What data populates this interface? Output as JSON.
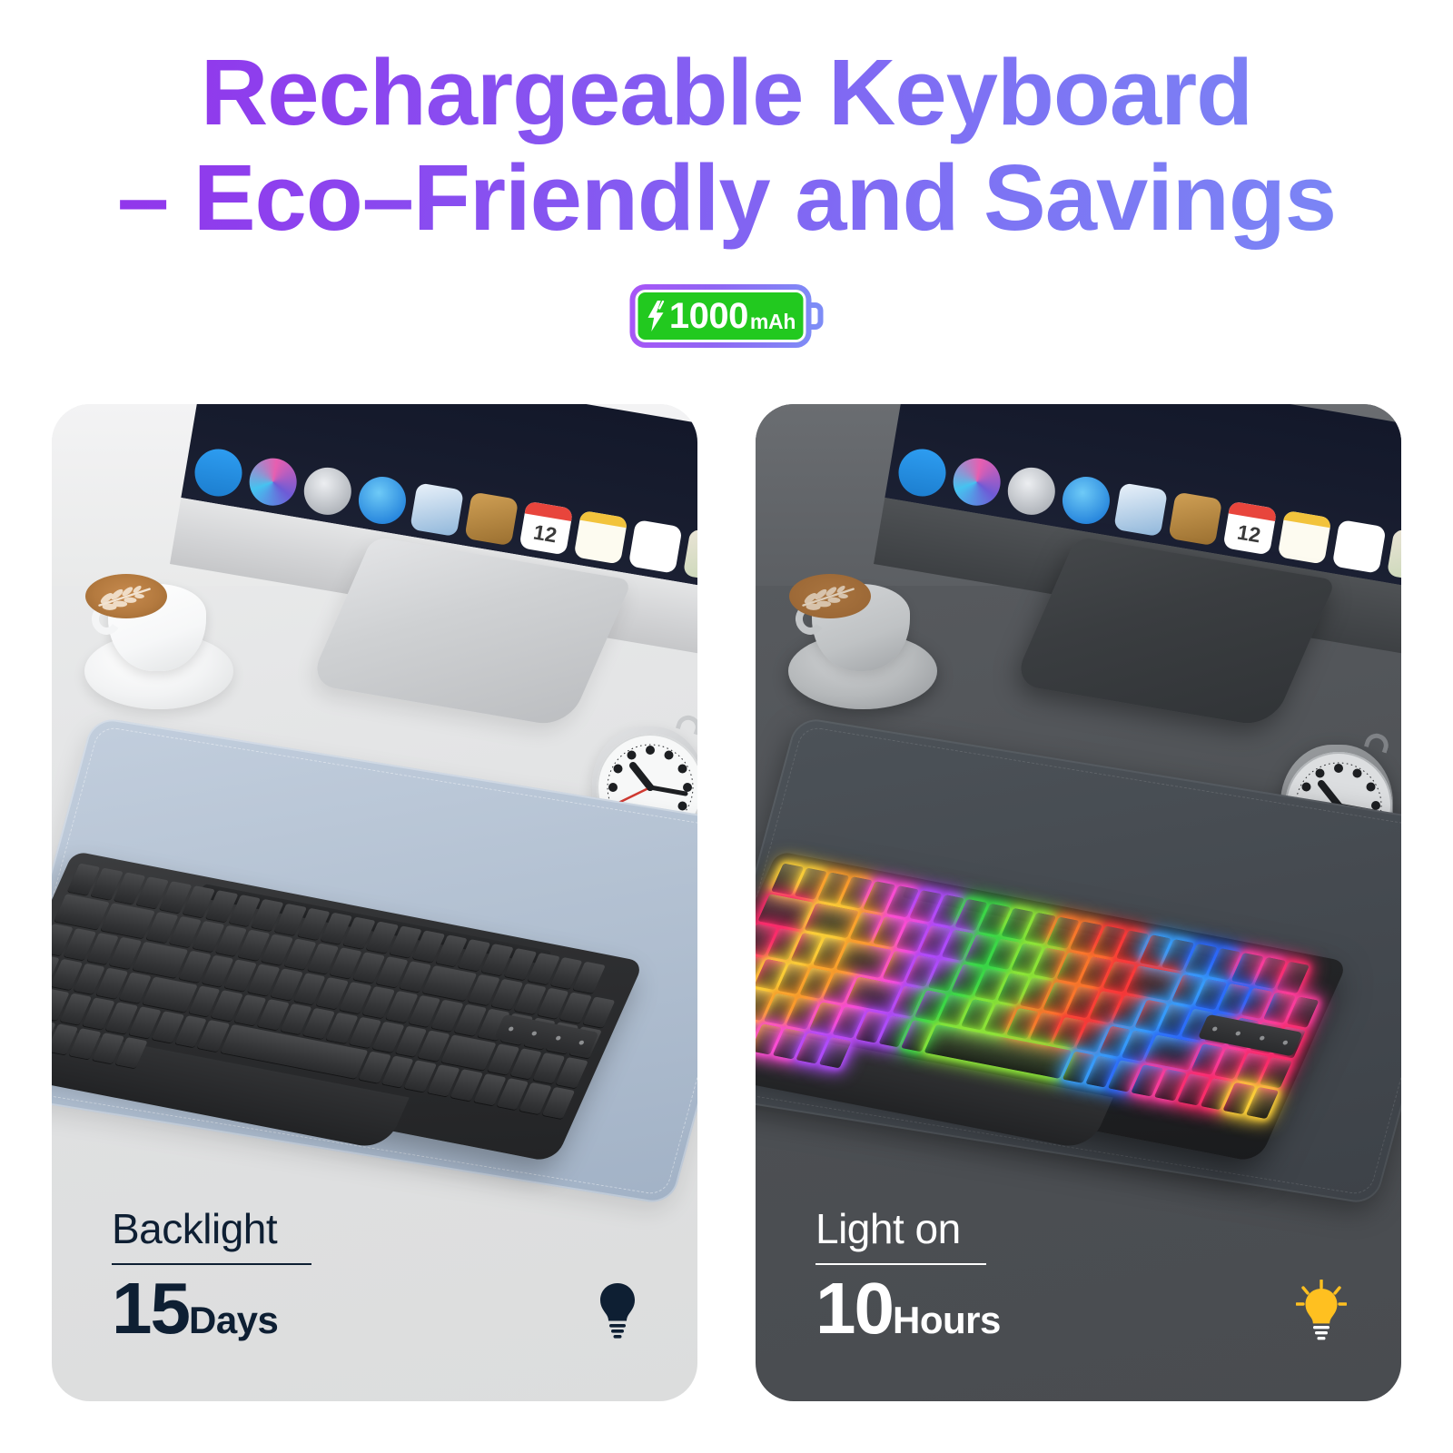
{
  "headline": {
    "line1": "Rechargeable Keyboard",
    "line2": "– Eco–Friendly and Savings",
    "full": "Rechargeable Keyboard\n– Eco–Friendly and Savings",
    "gradient_start": "#9333ea",
    "gradient_end": "#7b85f5"
  },
  "badge": {
    "capacity": "1000",
    "unit": "mAh",
    "icon": "lightning-bolt-icon",
    "fill_color": "#22c91f",
    "outline_gradient_start": "#a855f7",
    "outline_gradient_end": "#7e8cf6"
  },
  "panels": [
    {
      "id": "backlight-off",
      "scene": "bright-desk",
      "caption_label": "Backlight",
      "caption_number": "15",
      "caption_unit": "Days",
      "bulb_icon": "lightbulb-off-icon",
      "bulb_color": "#0e1f33",
      "text_color": "#0e1f33",
      "desk_color": "#e5e6e7",
      "mat_color": "#b3c1d2"
    },
    {
      "id": "backlight-on",
      "scene": "dark-desk",
      "caption_label": "Light on",
      "caption_number": "10",
      "caption_unit": "Hours",
      "bulb_icon": "lightbulb-on-icon",
      "bulb_color": "#ffc020",
      "text_color": "#ffffff",
      "desk_color": "#4c4f53",
      "mat_color": "#454a50"
    }
  ],
  "scene": {
    "monitor": "imac-display",
    "monitor_logo": "apple-logo-icon",
    "dock_icons": [
      "finder-icon",
      "siri-icon",
      "launchpad-icon",
      "safari-icon",
      "mail-icon",
      "contacts-icon",
      "calendar-icon",
      "notes-icon",
      "reminders-icon",
      "maps-icon",
      "photos-icon",
      "messages-icon",
      "facetime-icon",
      "news-icon",
      "numbers-icon"
    ],
    "dock_icon_colors": [
      "#2d9cf0",
      "#6e5bd6",
      "#c8cbd0",
      "#0f8df0",
      "#4a7fc4",
      "#b9893f",
      "#ffffff",
      "#fdf6d0",
      "#ffffff",
      "#eae3d3",
      "#f2f3f4",
      "#37b3f7",
      "#2ecc5a",
      "#f05a3c",
      "#2aa861"
    ],
    "calendar_day": "12",
    "coffee": "cappuccino-cup",
    "coffee_art": "rosetta-latte-art",
    "clock": "desk-alarm-clock",
    "clock_second_hand_color": "#d03a32",
    "keyboard": "full-size-wireless-keyboard",
    "keyboard_backlight_colors": [
      "#ffd23a",
      "#ff9f2e",
      "#ff4fd8",
      "#b24dff",
      "#3ddc4a",
      "#8fe83a",
      "#ff7a2e",
      "#ff3b3b",
      "#3aa0ff",
      "#2e6bff",
      "#ff3fa0",
      "#ff2e6e"
    ],
    "desk_mat": "pu-leather-desk-mat"
  }
}
